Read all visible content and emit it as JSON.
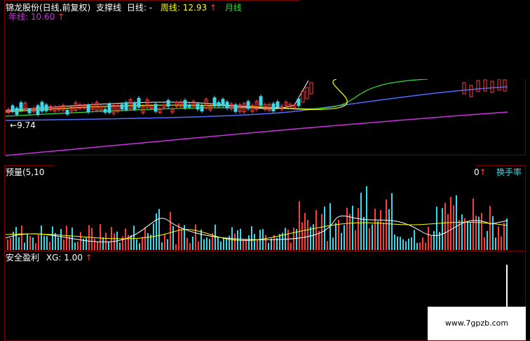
{
  "header": {
    "title": "锦龙股份(日线,前复权)",
    "indicator_name": "支撑线",
    "daily_label": "日线:",
    "daily_value": "-",
    "weekly_label": "周线:",
    "weekly_value": "12.93",
    "weekly_arrow": "↑",
    "monthly_label": "月线",
    "yearly_label": "年线:",
    "yearly_value": "10.60",
    "yearly_arrow": "↑"
  },
  "price_panel": {
    "low_marker": "9.74"
  },
  "volume_panel": {
    "title": "预量(5,10",
    "right_arrow": "↑",
    "right_partial_value": "0",
    "turnover_label": "换手率"
  },
  "indicator_panel": {
    "title": "安全盈利",
    "xg_label": "XG:",
    "xg_value": "1.00",
    "xg_arrow": "↑"
  },
  "watermark": "www.7gpzb.com",
  "colors": {
    "background": "#000000",
    "border": "#7a0000",
    "up": "#ff3b3b",
    "down": "#3fd7e6",
    "daily_line": "#ffffff",
    "weekly_line": "#ffff00",
    "monthly_line": "#33dd33",
    "quarter_line": "#4f6bff",
    "yearly_line": "#d12ee6",
    "text": "#ffffff"
  }
}
